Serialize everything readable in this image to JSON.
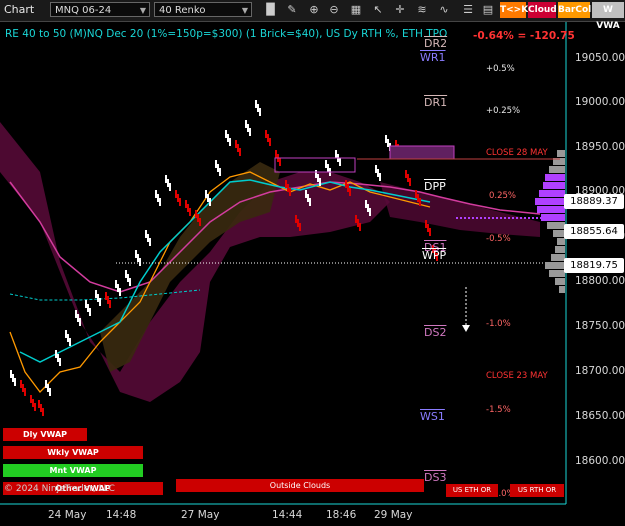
{
  "toolbar": {
    "title": "Chart",
    "instrument": "MNQ 06-24",
    "period": "40 Renko",
    "buttons": [
      {
        "label": "T<>K",
        "color": "#ff7a00"
      },
      {
        "label": "Cloud",
        "color": "#cc0033"
      },
      {
        "label": "BarCol",
        "color": "#ff9900"
      },
      {
        "label": "W VWA",
        "color": "#c0c0c0"
      }
    ]
  },
  "header": {
    "description": "RE 40 to 50 (M)NQ Dec 20 (1%=150p=$300) (1 Brick=$40), US Dy RTH %, ETH TPO",
    "change": "-0.64% = -120.75"
  },
  "levels": {
    "dr2": "DR2",
    "wr1": "WR1",
    "dr1": "DR1",
    "dpp": "DPP",
    "ds1": "DS1",
    "wpp": "WPP",
    "ds2": "DS2",
    "ws1": "WS1",
    "ds3": "DS3"
  },
  "pct_levels": {
    "p05": "+0.5%",
    "p025": "+0.25%",
    "close28": "CLOSE 28 MAY",
    "p025b": "0.25%",
    "m05": "-0.5%",
    "m10": "-1.0%",
    "close23": "CLOSE 23 MAY",
    "m15": "-1.5%",
    "m20": "-2.0%"
  },
  "y_axis": {
    "ticks": [
      "19050.00",
      "19000.00",
      "18950.00",
      "18900.00",
      "18850.00",
      "18800.00",
      "18750.00",
      "18700.00",
      "18650.00",
      "18600.00"
    ],
    "price_labels": [
      "18889.37",
      "18855.64",
      "18819.75"
    ]
  },
  "x_axis": {
    "ticks": [
      "24 May",
      "14:48",
      "27 May",
      "14:44",
      "18:46",
      "29 May"
    ]
  },
  "vwap": {
    "daily": "Dly VWAP",
    "weekly": "Wkly VWAP",
    "monthly": "Mnt VWAP",
    "other": "Other VWAP"
  },
  "footer": {
    "copyright": "© 2024 NinjaTrader, LLC",
    "outside_clouds": "Outside Clouds",
    "us_eth": "US ETH OR",
    "us_rth": "US RTH OR"
  },
  "colors": {
    "cloud": "#5a0a3a",
    "cloud_orange": "#3a2a10",
    "bull_brick": "#ffffff",
    "bear_brick": "#e00000",
    "tenkan": "#ff9900",
    "kijun": "#00cccc",
    "pink_line": "#d23c9e",
    "accent_cyan": "#1ad6d6"
  }
}
